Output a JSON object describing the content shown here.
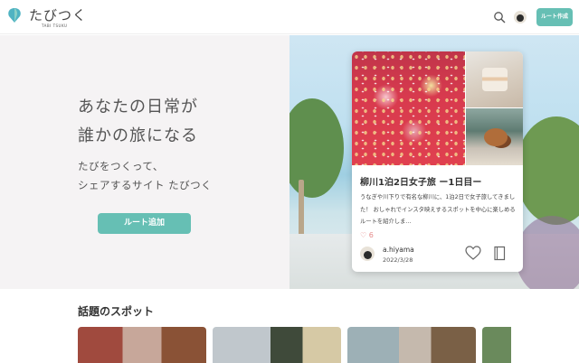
{
  "header": {
    "logo_text": "たびつく",
    "logo_sub": "TABI TSUKU",
    "create_button": "ルート作成"
  },
  "hero": {
    "tagline_1": "あなたの日常が",
    "tagline_2": "誰かの旅になる",
    "sub_1": "たびをつくって、",
    "sub_2": "シェアするサイト たびつく",
    "add_button": "ルート追加"
  },
  "card": {
    "title": "柳川1泊2日女子旅 ー1日目ー",
    "description": "うなぎや川下りで有名な柳川に、1泊2日で女子旅してきました！ おしゃれでインスタ映えするスポットを中心に楽しめるルートを紹介しま...",
    "likes": "6",
    "author": "a.hiyama",
    "date": "2022/3/28"
  },
  "spots": {
    "title": "話題のスポット"
  },
  "colors": {
    "accent": "#66bfb4",
    "logo_teal": "#4fb3c2"
  }
}
